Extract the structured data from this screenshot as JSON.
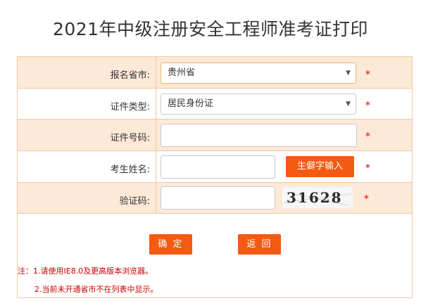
{
  "title": "2021年中级注册安全工程师准考证打印",
  "form": {
    "province": {
      "label": "报名省市:",
      "value": "贵州省"
    },
    "id_type": {
      "label": "证件类型:",
      "value": "居民身份证"
    },
    "id_number": {
      "label": "证件号码:",
      "value": ""
    },
    "name": {
      "label": "考生姓名:",
      "value": "",
      "rare_char_button": "生僻字输入"
    },
    "captcha": {
      "label": "验证码:",
      "value": "",
      "image_text": "31628"
    },
    "required_mark": "*"
  },
  "buttons": {
    "confirm": "确 定",
    "back": "返 回"
  },
  "notes": [
    "注：1.请使用IE8.0及更高版本浏览器。",
    "2.当前未开通省市不在列表中显示。"
  ],
  "colors": {
    "accent": "#f35a12",
    "row_alt": "#fce9d7",
    "border": "#f1c9a3",
    "required": "#e23c2a"
  }
}
